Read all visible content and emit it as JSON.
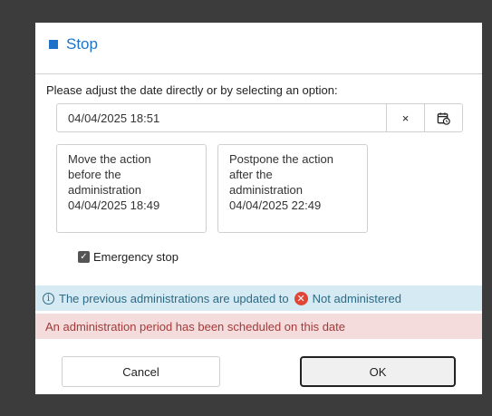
{
  "dialog": {
    "title": "Stop",
    "instruction": "Please adjust the date directly or by selecting an option:",
    "date_input": {
      "value": "04/04/2025 18:51",
      "clear_glyph": "×",
      "calendar_icon": "calendar-clock-icon"
    },
    "options": [
      {
        "lines": [
          "Move the action",
          "before the",
          "administration",
          "04/04/2025 18:49"
        ]
      },
      {
        "lines": [
          "Postpone the action",
          "after the",
          "administration",
          "04/04/2025 22:49"
        ]
      }
    ],
    "emergency_stop": {
      "label": "Emergency stop",
      "checked": true
    },
    "info_message": {
      "prefix": "The previous administrations are updated to",
      "status": "Not administered",
      "icon": "info-icon",
      "status_icon": "x-circle-icon"
    },
    "warning_message": "An administration period has been scheduled on this date",
    "buttons": {
      "cancel": "Cancel",
      "ok": "OK"
    }
  },
  "colors": {
    "accent": "#1e73c8",
    "info_bg": "#d6eaf3",
    "warning_bg": "#f5dcdc",
    "error_red": "#e04535"
  }
}
